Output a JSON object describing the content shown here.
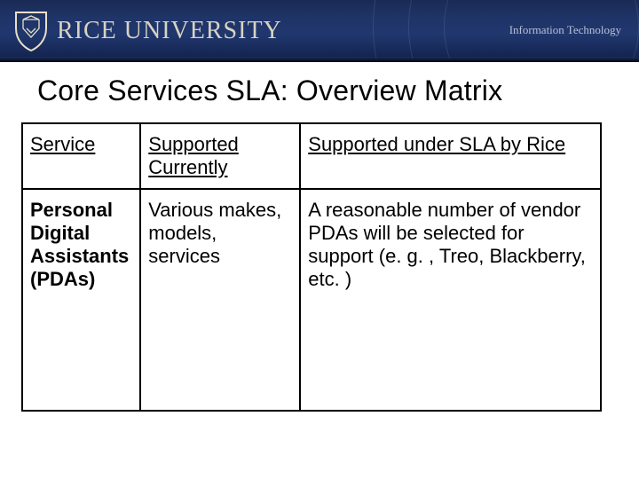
{
  "header": {
    "org_name": "RICE UNIVERSITY",
    "dept": "Information Technology",
    "shield_icon": "rice-shield-icon"
  },
  "slide": {
    "title": "Core Services SLA: Overview Matrix"
  },
  "table": {
    "headers": {
      "service": "Service",
      "supported_currently": "Supported Currently",
      "supported_under_sla": "Supported under SLA by Rice"
    },
    "rows": [
      {
        "service": "Personal Digital Assistants (PDAs)",
        "supported_currently": "Various makes, models, services",
        "supported_under_sla": "A reasonable number of vendor PDAs will be selected for support (e. g. , Treo, Blackberry, etc. )"
      }
    ]
  },
  "chart_data": {
    "type": "table",
    "title": "Core Services SLA: Overview Matrix",
    "columns": [
      "Service",
      "Supported Currently",
      "Supported under SLA by Rice"
    ],
    "rows": [
      [
        "Personal Digital Assistants (PDAs)",
        "Various makes, models, services",
        "A reasonable number of vendor PDAs will be selected for support (e. g. , Treo, Blackberry, etc. )"
      ]
    ]
  },
  "colors": {
    "header_gradient_top": "#1a2a56",
    "header_gradient_bottom": "#0a1736",
    "logo_tint": "#d7d2c2"
  }
}
